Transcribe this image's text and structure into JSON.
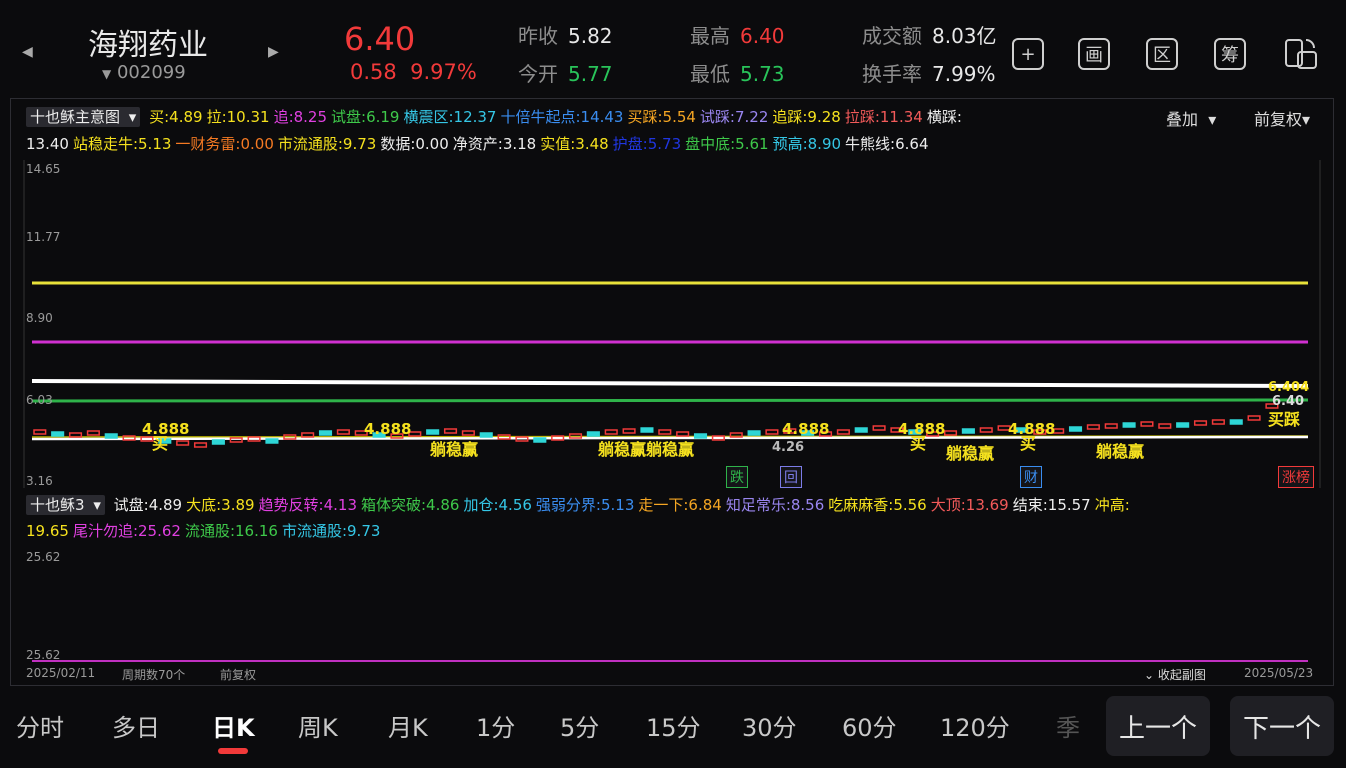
{
  "header": {
    "title": "海翔药业",
    "code": "002099",
    "price": "6.40",
    "change": "0.58",
    "change_pct": "9.97%",
    "quotes": [
      {
        "label": "昨收",
        "value": "5.82",
        "color": "#e8e8e8"
      },
      {
        "label": "今开",
        "value": "5.77",
        "color": "#29c45a"
      },
      {
        "label": "最高",
        "value": "6.40",
        "color": "#f23a3a"
      },
      {
        "label": "最低",
        "value": "5.73",
        "color": "#29c45a"
      },
      {
        "label": "成交额",
        "value": "8.03亿",
        "color": "#e8e8e8"
      },
      {
        "label": "换手率",
        "value": "7.99%",
        "color": "#e8e8e8"
      }
    ],
    "buttons": [
      "+",
      "画",
      "区",
      "筹"
    ]
  },
  "main_indicator": {
    "name": "十也稣主意图",
    "overlay_label": "叠加",
    "adjust_label": "前复权",
    "line1": [
      {
        "t": "买:4.89",
        "c": "#f5e11e"
      },
      {
        "t": "拉:10.31",
        "c": "#f5e11e"
      },
      {
        "t": "追:8.25",
        "c": "#e040e0"
      },
      {
        "t": "试盘:6.19",
        "c": "#3ec94a"
      },
      {
        "t": "横震区:12.37",
        "c": "#35c7e6"
      },
      {
        "t": "十倍牛起点:14.43",
        "c": "#3a8df0"
      },
      {
        "t": "买踩:5.54",
        "c": "#f5a623"
      },
      {
        "t": "试踩:7.22",
        "c": "#9a86f0"
      },
      {
        "t": "追踩:9.28",
        "c": "#f5e11e"
      },
      {
        "t": "拉踩:11.34",
        "c": "#f25a5a"
      },
      {
        "t": "横踩:",
        "c": "#eeeeee"
      }
    ],
    "line2": [
      {
        "t": "13.40",
        "c": "#eeeeee"
      },
      {
        "t": "站稳走牛:5.13",
        "c": "#f5e11e"
      },
      {
        "t": "一财务雷:0.00",
        "c": "#f57a23"
      },
      {
        "t": "市流通股:9.73",
        "c": "#f5e11e"
      },
      {
        "t": "数据:0.00",
        "c": "#eeeeee"
      },
      {
        "t": "净资产:3.18",
        "c": "#eeeeee"
      },
      {
        "t": "实值:3.48",
        "c": "#f5e11e"
      },
      {
        "t": "护盘:5.73",
        "c": "#2036e0"
      },
      {
        "t": "盘中底:5.61",
        "c": "#3ec94a"
      },
      {
        "t": "预高:8.90",
        "c": "#35c7e6"
      },
      {
        "t": "牛熊线:6.64",
        "c": "#eeeeee"
      }
    ],
    "y_labels": [
      "14.65",
      "11.77",
      "8.90",
      "6.03",
      "3.16"
    ],
    "annotations": {
      "val_label": "4.888",
      "buy_label": "买",
      "stable_label": "躺稳赢",
      "stable_double": "躺稳赢躺稳赢",
      "low_label": "4.26",
      "right_val1": "6.404",
      "right_val2": "6.40",
      "right_buy": "买踩",
      "tag_die": "跌",
      "tag_hui": "回",
      "tag_cai": "财",
      "tag_zhang": "涨榜"
    }
  },
  "sub_indicator": {
    "name": "十也稣3",
    "line1": [
      {
        "t": "试盘:4.89",
        "c": "#eeeeee"
      },
      {
        "t": "大底:3.89",
        "c": "#f5e11e"
      },
      {
        "t": "趋势反转:4.13",
        "c": "#e040e0"
      },
      {
        "t": "箱体突破:4.86",
        "c": "#3ec94a"
      },
      {
        "t": "加仓:4.56",
        "c": "#35c7e6"
      },
      {
        "t": "强弱分界:5.13",
        "c": "#3a8df0"
      },
      {
        "t": "走一下:6.84",
        "c": "#f5a623"
      },
      {
        "t": "知足常乐:8.56",
        "c": "#9a86f0"
      },
      {
        "t": "吃麻麻香:5.56",
        "c": "#f5e11e"
      },
      {
        "t": "大顶:13.69",
        "c": "#f25a5a"
      },
      {
        "t": "结束:15.57",
        "c": "#eeeeee"
      },
      {
        "t": "冲高:",
        "c": "#f5e11e"
      }
    ],
    "line2": [
      {
        "t": "19.65",
        "c": "#f5e11e"
      },
      {
        "t": "尾汁勿追:25.62",
        "c": "#e040e0"
      },
      {
        "t": "流通股:16.16",
        "c": "#3ec94a"
      },
      {
        "t": "市流通股:9.73",
        "c": "#35c7e6"
      }
    ],
    "y_labels": [
      "25.62",
      "25.62"
    ]
  },
  "footer": {
    "start_date": "2025/02/11",
    "period": "周期数70个",
    "adjust": "前复权",
    "collapse": "收起副图",
    "end_date": "2025/05/23"
  },
  "tabs": [
    "分时",
    "多日",
    "日K",
    "周K",
    "月K",
    "1分",
    "5分",
    "15分",
    "30分",
    "60分",
    "120分",
    "季"
  ],
  "active_tab": "日K",
  "prev_label": "上一个",
  "next_label": "下一个"
}
